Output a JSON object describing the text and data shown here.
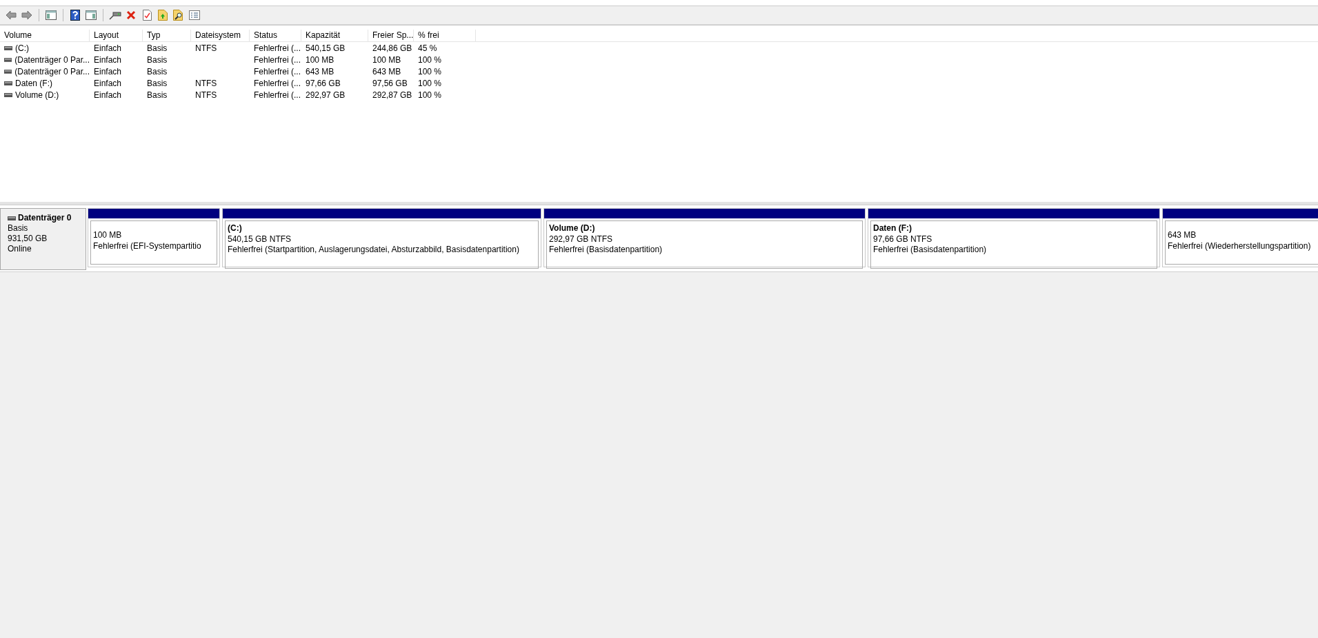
{
  "toolbar": [
    {
      "kind": "back"
    },
    {
      "kind": "forward"
    },
    {
      "kind": "sep"
    },
    {
      "kind": "tree"
    },
    {
      "kind": "sep"
    },
    {
      "kind": "help"
    },
    {
      "kind": "pane"
    },
    {
      "kind": "sep"
    },
    {
      "kind": "connect"
    },
    {
      "kind": "delete"
    },
    {
      "kind": "properties"
    },
    {
      "kind": "folder-up"
    },
    {
      "kind": "folder-search"
    },
    {
      "kind": "list"
    }
  ],
  "table": {
    "columns": [
      "Volume",
      "Layout",
      "Typ",
      "Dateisystem",
      "Status",
      "Kapazität",
      "Freier Sp...",
      "% frei"
    ],
    "rows": [
      [
        "(C:)",
        "Einfach",
        "Basis",
        "NTFS",
        "Fehlerfrei (...",
        "540,15 GB",
        "244,86 GB",
        "45 %"
      ],
      [
        "(Datenträger 0 Par...",
        "Einfach",
        "Basis",
        "",
        "Fehlerfrei (...",
        "100 MB",
        "100 MB",
        "100 %"
      ],
      [
        "(Datenträger 0 Par...",
        "Einfach",
        "Basis",
        "",
        "Fehlerfrei (...",
        "643 MB",
        "643 MB",
        "100 %"
      ],
      [
        "Daten (F:)",
        "Einfach",
        "Basis",
        "NTFS",
        "Fehlerfrei (...",
        "97,66 GB",
        "97,56 GB",
        "100 %"
      ],
      [
        "Volume (D:)",
        "Einfach",
        "Basis",
        "NTFS",
        "Fehlerfrei (...",
        "292,97 GB",
        "292,87 GB",
        "100 %"
      ]
    ]
  },
  "disk": {
    "name": "Datenträger 0",
    "type": "Basis",
    "size": "931,50 GB",
    "state": "Online",
    "partitions": [
      {
        "size": "100 MB",
        "status": "Fehlerfrei (EFI-Systempartitio"
      },
      {
        "title": "(C:)",
        "size": "540,15 GB NTFS",
        "status": "Fehlerfrei (Startpartition, Auslagerungsdatei, Absturzabbild, Basisdatenpartition)"
      },
      {
        "title": "Volume  (D:)",
        "size": "292,97 GB NTFS",
        "status": "Fehlerfrei (Basisdatenpartition)"
      },
      {
        "title": "Daten  (F:)",
        "size": "97,66 GB NTFS",
        "status": "Fehlerfrei (Basisdatenpartition)"
      },
      {
        "size": "643 MB",
        "status": "Fehlerfrei (Wiederherstellungspartition)"
      }
    ]
  }
}
